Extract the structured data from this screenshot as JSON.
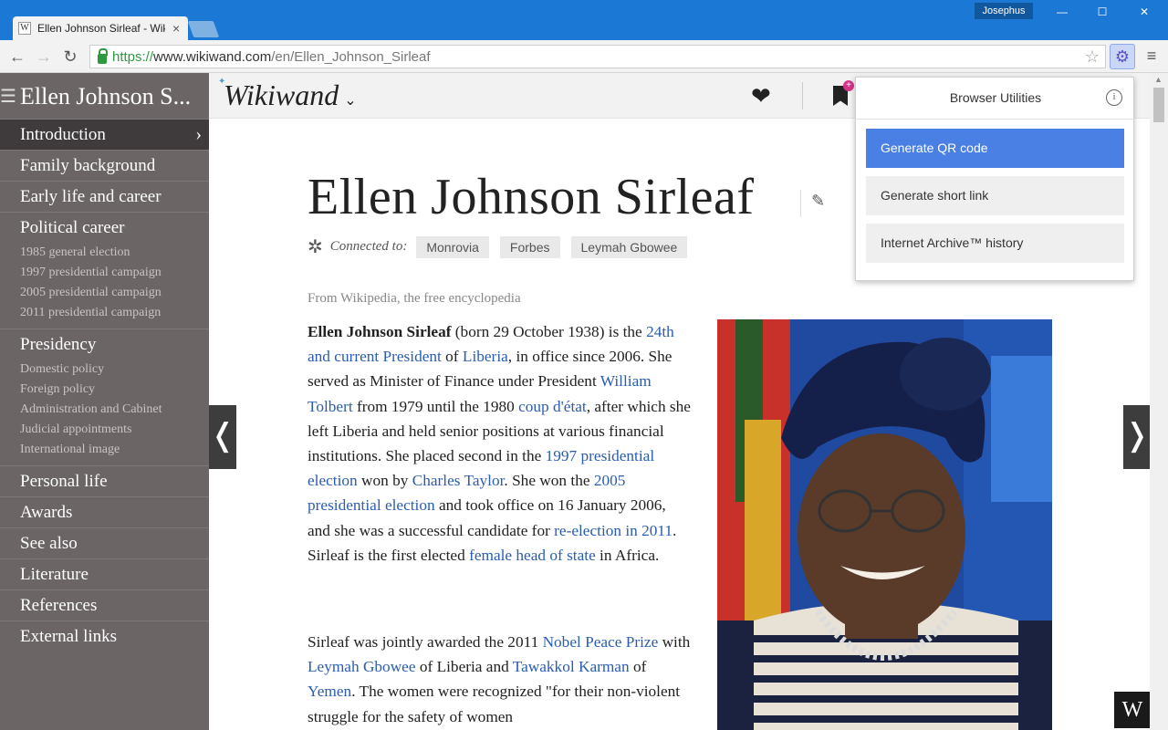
{
  "browser": {
    "tab_title": "Ellen Johnson Sirleaf - Wik",
    "favicon": "W",
    "tab_close": "×",
    "profile_name": "Josephus",
    "url_scheme": "https://",
    "url_host": "www.wikiwand.com",
    "url_path": "/en/Ellen_Johnson_Sirleaf",
    "icons": [
      "back-arrow-icon",
      "forward-arrow-icon",
      "reload-icon",
      "lock-icon",
      "star-icon",
      "gear-icon",
      "menu-icon"
    ]
  },
  "sidebar": {
    "title": "Ellen Johnson S...",
    "sections": [
      {
        "label": "Introduction",
        "active": true,
        "subs": []
      },
      {
        "label": "Family background",
        "subs": []
      },
      {
        "label": "Early life and career",
        "subs": []
      },
      {
        "label": "Political career",
        "subs": [
          "1985 general election",
          "1997 presidential campaign",
          "2005 presidential campaign",
          "2011 presidential campaign"
        ]
      },
      {
        "label": "Presidency",
        "subs": [
          "Domestic policy",
          "Foreign policy",
          "Administration and Cabinet",
          "Judicial appointments",
          "International image"
        ]
      },
      {
        "label": "Personal life",
        "subs": []
      },
      {
        "label": "Awards",
        "subs": []
      },
      {
        "label": "See also",
        "subs": []
      },
      {
        "label": "Literature",
        "subs": []
      },
      {
        "label": "References",
        "subs": []
      },
      {
        "label": "External links",
        "subs": []
      }
    ]
  },
  "header": {
    "logo": "Wikiwand",
    "bookmark_badge": "+"
  },
  "article": {
    "title": "Ellen Johnson Sirleaf",
    "connected_label": "Connected to:",
    "connected": [
      "Monrovia",
      "Forbes",
      "Leymah Gbowee"
    ],
    "from_wiki": "From Wikipedia, the free encyclopedia",
    "p1": [
      {
        "t": "Ellen Johnson Sirleaf",
        "b": true
      },
      {
        "t": " (born 29 October 1938) is the "
      },
      {
        "t": "24th and current President",
        "l": true
      },
      {
        "t": " of "
      },
      {
        "t": "Liberia",
        "l": true
      },
      {
        "t": ", in office since 2006. She served as Minister of Finance under President "
      },
      {
        "t": "William Tolbert",
        "l": true
      },
      {
        "t": " from 1979 until the 1980 "
      },
      {
        "t": "coup d'état",
        "l": true
      },
      {
        "t": ", after which she left Liberia and held senior positions at various financial institutions. She placed second in the "
      },
      {
        "t": "1997 presidential election",
        "l": true
      },
      {
        "t": " won by "
      },
      {
        "t": "Charles Taylor",
        "l": true
      },
      {
        "t": ". She won the "
      },
      {
        "t": "2005 presidential election",
        "l": true
      },
      {
        "t": " and took office on 16 January 2006, and she was a successful candidate for "
      },
      {
        "t": "re-election in 2011",
        "l": true
      },
      {
        "t": ". Sirleaf is the first elected "
      },
      {
        "t": "female head of state",
        "l": true
      },
      {
        "t": " in Africa."
      }
    ],
    "p2": [
      {
        "t": "Sirleaf was jointly awarded the 2011 "
      },
      {
        "t": "Nobel Peace Prize",
        "l": true
      },
      {
        "t": " with "
      },
      {
        "t": "Leymah Gbowee",
        "l": true
      },
      {
        "t": " of Liberia and "
      },
      {
        "t": "Tawakkol Karman",
        "l": true
      },
      {
        "t": " of "
      },
      {
        "t": "Yemen",
        "l": true
      },
      {
        "t": ". The women were recognized \"for their non-violent struggle for the safety of women"
      }
    ],
    "prev_arrow": "❬",
    "next_arrow": "❭",
    "corner_logo": "W"
  },
  "popup": {
    "title": "Browser Utilities",
    "info": "i",
    "buttons": [
      "Generate QR code",
      "Generate short link",
      "Internet Archive™ history"
    ]
  },
  "colors": {
    "chrome_blue": "#1b78d4",
    "sidebar": "#6b6566",
    "sidebar_active": "#3f3a3b",
    "link": "#2a5db0",
    "primary_button": "#4a7fe4"
  }
}
